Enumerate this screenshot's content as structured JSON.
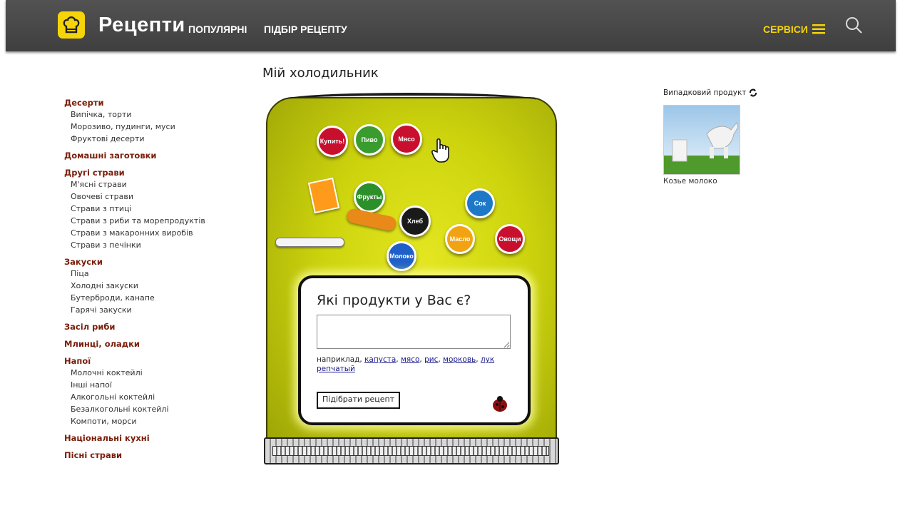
{
  "header": {
    "logo": "Рецепти",
    "nav": [
      "ПОПУЛЯРНІ",
      "ПІДБІР РЕЦЕПТУ"
    ],
    "services": "СЕРВІСИ",
    "accent": "#f5d50a",
    "bar_color": "#4a4a4a"
  },
  "page_title": "Мій холодильник",
  "sidebar": {
    "categories": [
      {
        "label": "Десерти",
        "items": [
          "Випічка, торти",
          "Морозиво, пудинги, муси",
          "Фруктові десерти"
        ]
      },
      {
        "label": "Домашні заготовки",
        "items": []
      },
      {
        "label": "Другі страви",
        "items": [
          "М'ясні страви",
          "Овочеві страви",
          "Страви з птиці",
          "Страви з риби та морепродуктів",
          "Страви з макаронних виробів",
          "Страви з печінки"
        ]
      },
      {
        "label": "Закуски",
        "items": [
          "Піца",
          "Холодні закуски",
          "Бутерброди, канапе",
          "Гарячі закуски"
        ]
      },
      {
        "label": "Засіл риби",
        "items": []
      },
      {
        "label": "Млинці, оладки",
        "items": []
      },
      {
        "label": "Напої",
        "items": [
          "Молочні коктейлі",
          "Інші напої",
          "Алкогольні коктейлі",
          "Безалкогольні коктейлі",
          "Компоти, морси"
        ]
      },
      {
        "label": "Національні кухні",
        "items": []
      },
      {
        "label": "Пісні страви",
        "items": []
      }
    ]
  },
  "fridge": {
    "magnets": [
      "Купить!",
      "Пиво",
      "Мясо",
      "Фрукты",
      "Хлеб",
      "Сок",
      "Масло",
      "Овощи",
      "Молоко"
    ],
    "question": "Які продукти у Вас є?",
    "input_value": "",
    "hint_prefix": "наприклад,",
    "hint_links": [
      "капуста",
      "мясо",
      "рис",
      "морковь",
      "лук репчатый"
    ],
    "button": "Підібрати рецепт"
  },
  "random_product": {
    "title": "Випадковий продукт",
    "name": "Козье молоко"
  }
}
